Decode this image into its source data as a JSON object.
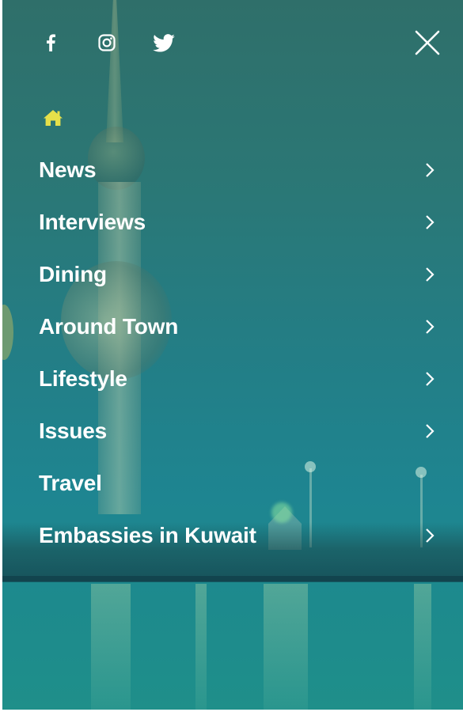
{
  "social": {
    "items": [
      {
        "name": "facebook",
        "icon": "facebook-icon",
        "glyph": "f"
      },
      {
        "name": "instagram",
        "icon": "instagram-icon"
      },
      {
        "name": "twitter",
        "icon": "twitter-icon"
      }
    ]
  },
  "close": {
    "icon": "close-icon"
  },
  "home": {
    "icon": "home-icon",
    "color": "#e6e04a"
  },
  "nav": {
    "items": [
      {
        "label": "News",
        "has_submenu": true
      },
      {
        "label": "Interviews",
        "has_submenu": true
      },
      {
        "label": "Dining",
        "has_submenu": true
      },
      {
        "label": "Around Town",
        "has_submenu": true
      },
      {
        "label": "Lifestyle",
        "has_submenu": true
      },
      {
        "label": "Issues",
        "has_submenu": true
      },
      {
        "label": "Travel",
        "has_submenu": false
      },
      {
        "label": "Embassies in Kuwait",
        "has_submenu": true
      }
    ]
  },
  "colors": {
    "overlay_top": "#2f6f6a",
    "overlay_bottom": "#1f8f8a",
    "text": "#ffffff",
    "home_accent": "#e6e04a"
  }
}
